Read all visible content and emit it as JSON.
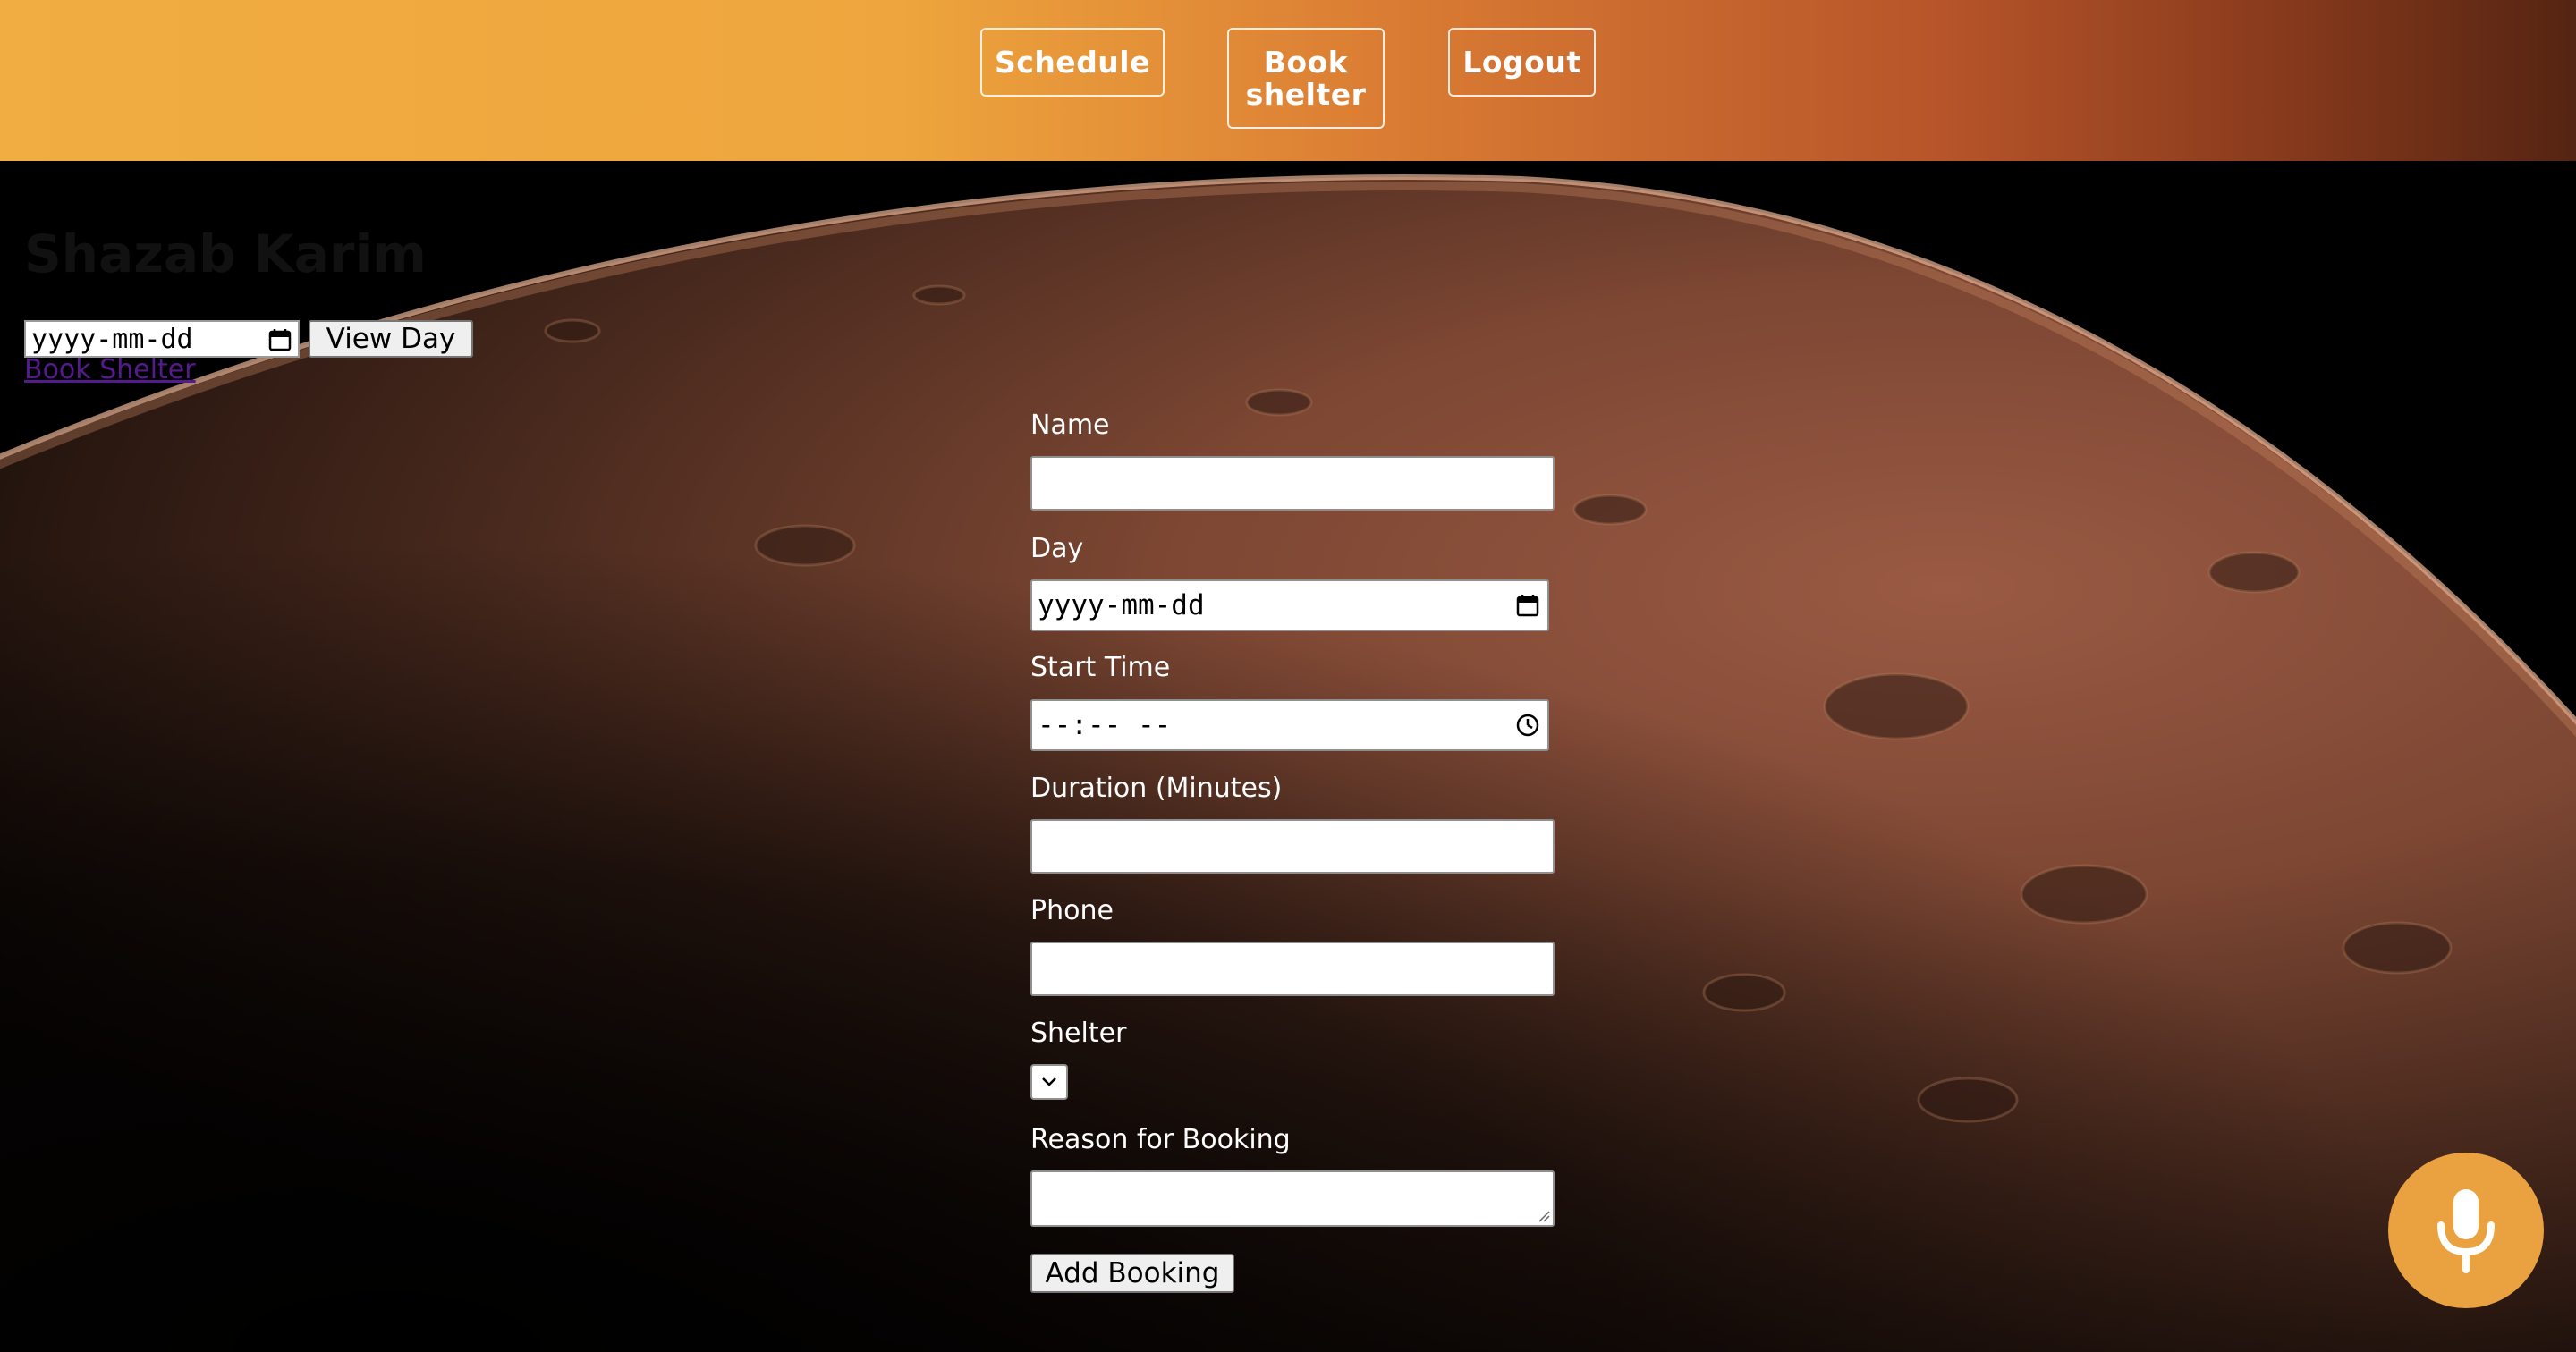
{
  "header": {
    "nav": {
      "schedule": "Schedule",
      "book_line1": "Book",
      "book_line2": "shelter",
      "logout": "Logout"
    }
  },
  "sidebar": {
    "user_name": "Shazab Karim",
    "date_placeholder": "yyyy-mm-dd",
    "view_day_label": "View Day",
    "book_shelter_link": "Book Shelter"
  },
  "form": {
    "name_label": "Name",
    "name_value": "",
    "day_label": "Day",
    "day_placeholder": "yyyy-mm-dd",
    "start_time_label": "Start Time",
    "start_time_placeholder": "--:-- --",
    "duration_label": "Duration (Minutes)",
    "duration_value": "",
    "phone_label": "Phone",
    "phone_value": "",
    "shelter_label": "Shelter",
    "shelter_selected": "",
    "reason_label": "Reason for Booking",
    "reason_value": "",
    "submit_label": "Add Booking"
  },
  "icons": {
    "calendar": "calendar-icon",
    "clock": "clock-icon",
    "chevron": "chevron-down-icon",
    "microphone": "microphone-icon"
  },
  "colors": {
    "header_start": "#f1ad41",
    "header_end": "#552412",
    "mic_button": "#e9a23f",
    "link": "#551a8b"
  }
}
